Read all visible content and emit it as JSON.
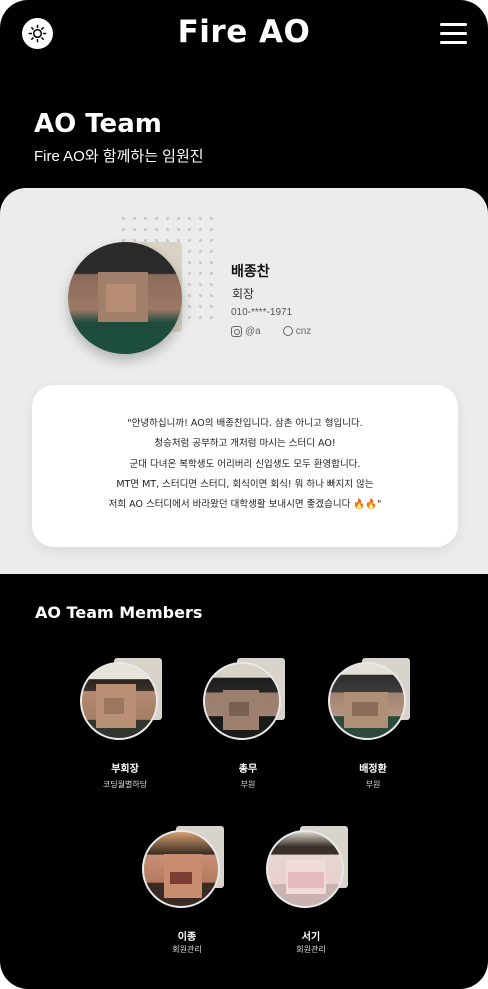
{
  "header": {
    "brand": "Fire AO",
    "theme_icon": "sun-icon",
    "menu_icon": "hamburger-menu-icon"
  },
  "hero": {
    "title": "AO Team",
    "subtitle": "Fire AO와 함께하는 임원진"
  },
  "leader": {
    "name": "배종찬",
    "role": "회장",
    "contact": "010-****-1971",
    "instagram": "@a",
    "github": "cnz",
    "quote_lines": [
      "\"안녕하십니까! AO의 배종찬입니다. 삼촌 아니고 형입니다.",
      "청승처럼 공부하고 개처럼 마시는 스터디 AO!",
      "군대 다녀온 복학생도 어리버리 신입생도 모두 환영합니다.",
      "MT면 MT, 스터디면 스터디, 회식이면 회식! 뭐 하나 빠지지 않는",
      "저희 AO 스터디에서 바라왔던 대학생활 보내시면 좋겠습니다 🔥🔥\""
    ]
  },
  "members": {
    "title": "AO Team Members",
    "list": [
      {
        "name": "부회장",
        "role": "코딩월별하당"
      },
      {
        "name": "총무",
        "role": "부원"
      },
      {
        "name": "배정환",
        "role": "부원"
      },
      {
        "name": "이종",
        "role": "회원관리"
      },
      {
        "name": "서기",
        "role": "회원관리"
      }
    ]
  },
  "colors": {
    "background": "#000000",
    "section": "#ececec",
    "card": "#ffffff",
    "text_light": "#ffffff"
  }
}
